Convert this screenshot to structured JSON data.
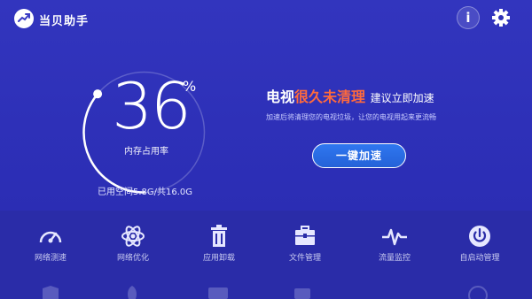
{
  "app": {
    "title": "当贝助手"
  },
  "toolbar": {
    "info_label": "i"
  },
  "gauge": {
    "percent": "36",
    "percent_sign": "%",
    "label": "内存占用率",
    "usage": "已用空间5.8G/共16.0G",
    "fill_fraction": 0.36
  },
  "promo": {
    "headline_a": "电视",
    "headline_b": "很久未清理",
    "headline_c": "建议立即加速",
    "subline": "加速后将清理您的电视垃圾，让您的电视用起来更流畅",
    "button": "一键加速"
  },
  "tools": [
    {
      "label": "网络测速",
      "icon": "speedometer-icon"
    },
    {
      "label": "网络优化",
      "icon": "atom-icon"
    },
    {
      "label": "应用卸载",
      "icon": "trash-icon"
    },
    {
      "label": "文件管理",
      "icon": "briefcase-icon"
    },
    {
      "label": "流量监控",
      "icon": "pulse-icon"
    },
    {
      "label": "自启动管理",
      "icon": "power-icon"
    }
  ],
  "colors": {
    "background": "#2d2fb0",
    "accent_red": "#ff6a3c",
    "button_blue": "#2f77f0"
  }
}
